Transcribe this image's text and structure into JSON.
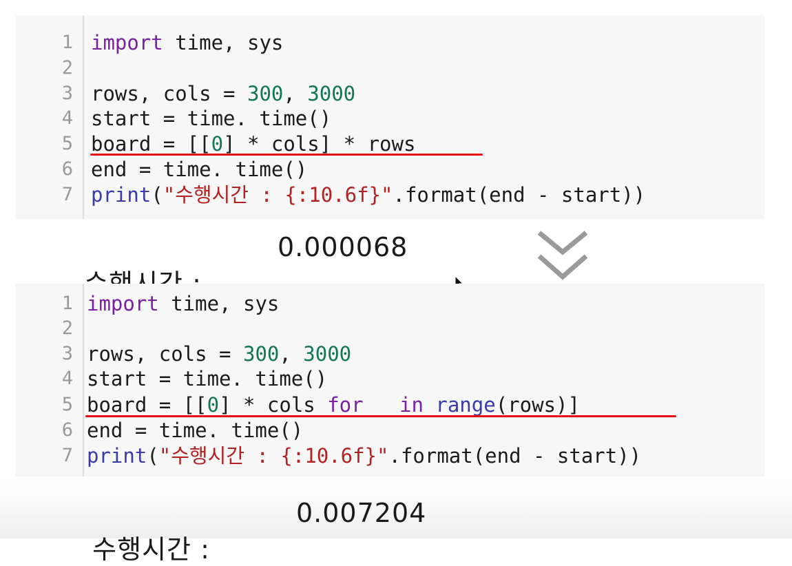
{
  "cells": [
    {
      "lines": [
        {
          "n": "1",
          "parts": [
            {
              "t": "import",
              "c": "kw"
            },
            {
              "t": " time, sys",
              "c": ""
            }
          ]
        },
        {
          "n": "2",
          "parts": []
        },
        {
          "n": "3",
          "parts": [
            {
              "t": "rows, cols = ",
              "c": ""
            },
            {
              "t": "300",
              "c": "num"
            },
            {
              "t": ", ",
              "c": ""
            },
            {
              "t": "3000",
              "c": "num"
            }
          ]
        },
        {
          "n": "4",
          "parts": [
            {
              "t": "start = time. time()",
              "c": ""
            }
          ]
        },
        {
          "n": "5",
          "parts": [
            {
              "t": "board = [[",
              "c": ""
            },
            {
              "t": "0",
              "c": "num"
            },
            {
              "t": "] * cols] * rows",
              "c": ""
            }
          ]
        },
        {
          "n": "6",
          "parts": [
            {
              "t": "end = time. time()",
              "c": ""
            }
          ]
        },
        {
          "n": "7",
          "parts": [
            {
              "t": "print",
              "c": "bi"
            },
            {
              "t": "(",
              "c": ""
            },
            {
              "t": "\"수행시간 : {:10.6f}\"",
              "c": "str"
            },
            {
              "t": ".format(end - start))",
              "c": ""
            }
          ]
        }
      ]
    },
    {
      "lines": [
        {
          "n": "1",
          "parts": [
            {
              "t": "import",
              "c": "kw"
            },
            {
              "t": " time, sys",
              "c": ""
            }
          ]
        },
        {
          "n": "2",
          "parts": []
        },
        {
          "n": "3",
          "parts": [
            {
              "t": "rows, cols = ",
              "c": ""
            },
            {
              "t": "300",
              "c": "num"
            },
            {
              "t": ", ",
              "c": ""
            },
            {
              "t": "3000",
              "c": "num"
            }
          ]
        },
        {
          "n": "4",
          "parts": [
            {
              "t": "start = time. time()",
              "c": ""
            }
          ]
        },
        {
          "n": "5",
          "parts": [
            {
              "t": "board = [[",
              "c": ""
            },
            {
              "t": "0",
              "c": "num"
            },
            {
              "t": "] * cols ",
              "c": ""
            },
            {
              "t": "for",
              "c": "kw"
            },
            {
              "t": " _ ",
              "c": ""
            },
            {
              "t": "in",
              "c": "kw"
            },
            {
              "t": " ",
              "c": ""
            },
            {
              "t": "range",
              "c": "bi"
            },
            {
              "t": "(rows)]",
              "c": ""
            }
          ]
        },
        {
          "n": "6",
          "parts": [
            {
              "t": "end = time. time()",
              "c": ""
            }
          ]
        },
        {
          "n": "7",
          "parts": [
            {
              "t": "print",
              "c": "bi"
            },
            {
              "t": "(",
              "c": ""
            },
            {
              "t": "\"수행시간 : {:10.6f}\"",
              "c": "str"
            },
            {
              "t": ".format(end - start))",
              "c": ""
            }
          ]
        }
      ]
    }
  ],
  "outputs": [
    {
      "label": "수행시간 :",
      "value": "0.000068"
    },
    {
      "label": "수행시간 :",
      "value": "0.007204"
    }
  ],
  "icons": {
    "arrow": "double-chevron-down-icon",
    "cursor": "mouse-cursor-icon"
  },
  "colors": {
    "underline": "#e81010",
    "keyword": "#7a1fa2",
    "number": "#117755",
    "string": "#b22222"
  }
}
